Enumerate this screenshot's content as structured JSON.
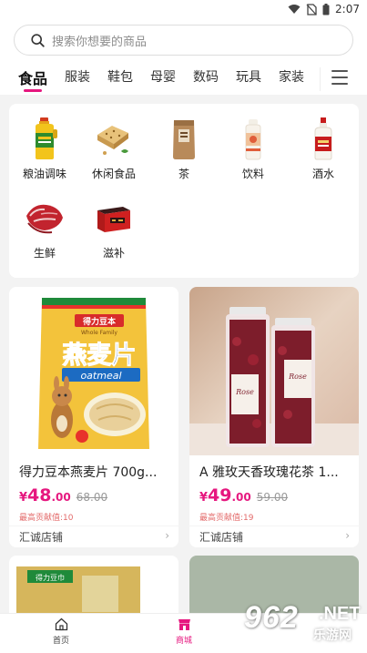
{
  "status_bar": {
    "time": "2:07"
  },
  "search": {
    "placeholder": "搜索你想要的商品"
  },
  "tabs": [
    {
      "label": "食品",
      "active": true
    },
    {
      "label": "服装"
    },
    {
      "label": "鞋包"
    },
    {
      "label": "母婴"
    },
    {
      "label": "数码"
    },
    {
      "label": "玩具"
    },
    {
      "label": "家装"
    }
  ],
  "categories": [
    {
      "label": "粮油调味",
      "icon": "cooking-oil-icon"
    },
    {
      "label": "休闲食品",
      "icon": "snack-icon"
    },
    {
      "label": "茶",
      "icon": "tea-bag-icon"
    },
    {
      "label": "饮料",
      "icon": "drink-bottle-icon"
    },
    {
      "label": "酒水",
      "icon": "liquor-bottle-icon"
    },
    {
      "label": "生鲜",
      "icon": "fresh-meat-icon"
    },
    {
      "label": "滋补",
      "icon": "tonic-box-icon"
    }
  ],
  "products": [
    {
      "title": "得力豆本燕麦片 700g...",
      "currency": "¥",
      "price_int": "48",
      "price_dec": ".00",
      "orig_price": "68.00",
      "contribution": "最高贡献值:10",
      "store": "汇诚店铺",
      "package_text": {
        "brand": "得力豆本",
        "name": "燕麦片",
        "en": "oatmeal",
        "family": "Whole Family"
      }
    },
    {
      "title": "A 雅玫天香玫瑰花茶 1...",
      "currency": "¥",
      "price_int": "49",
      "price_dec": ".00",
      "orig_price": "59.00",
      "contribution": "最高贡献值:19",
      "store": "汇诚店铺",
      "package_text": {
        "label": "Rose"
      }
    }
  ],
  "partial_card": {
    "brand": "得力豆巾"
  },
  "bottom_nav": [
    {
      "label": "首页",
      "icon": "home-icon"
    },
    {
      "label": "商城",
      "icon": "shop-icon",
      "active": true
    }
  ],
  "watermark": {
    "text": "962",
    "net": ".NET",
    "sub": "乐游网"
  },
  "colors": {
    "accent": "#e6177f",
    "background": "#f3f3f3"
  }
}
